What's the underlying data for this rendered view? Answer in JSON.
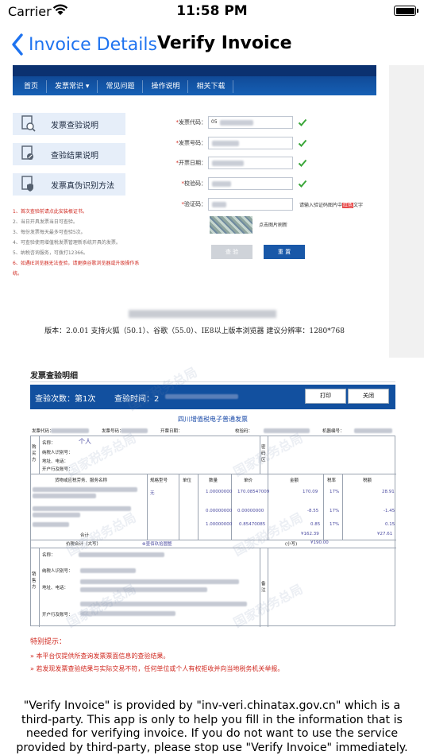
{
  "status_bar": {
    "carrier": "Carrier",
    "time": "11:58 PM"
  },
  "nav": {
    "back_label": "Invoice Details",
    "title": "Verify Invoice"
  },
  "query_page": {
    "menu": [
      "首页",
      "发票常识",
      "常见问题",
      "操作说明",
      "相关下载"
    ],
    "side_buttons": [
      "发票查验说明",
      "查验结果说明",
      "发票真伪识别方法"
    ],
    "tips": [
      "1、首次查验前请点此安装根证书。",
      "2、当日开具发票当日可查验。",
      "3、每份发票每天最多可查验5次。",
      "4、可查验使用增值税发票管理新系统开具的发票。",
      "5、纳税咨询服务，可拨打12366。",
      "6、如遇IE浏览器无法查验，请更换谷歌浏览器或升级操作系统。"
    ],
    "form": {
      "code_label": "发票代码：",
      "code_value": "05",
      "number_label": "发票号码：",
      "date_label": "开票日期：",
      "checkcode_label": "校验码：",
      "captcha_label": "验证码：",
      "captcha_hint_pre": "请输入验证码图片中",
      "captcha_hint_hl": "红色",
      "captcha_hint_post": "文字",
      "captcha_refresh": "点击图片刷新",
      "btn_check": "查 验",
      "btn_reset": "重 置"
    },
    "version_line": "版本：2.0.01  支持火狐（50.1）、谷歌（55.0）、IE8以上版本浏览器  建议分辨率：1280*768"
  },
  "detail_page": {
    "heading": "发票查验明细",
    "check_count": "查验次数：第1次",
    "check_time_label": "查验时间：2",
    "btn_print": "打印",
    "btn_close": "关闭",
    "invoice_title": "四川增值税电子普通发票",
    "meta": {
      "code": "发票代码：",
      "number": "发票号码：",
      "date": "开票日期：",
      "checkcode": "校验码：",
      "machine": "机器编号："
    },
    "buyer": {
      "side": "购买方",
      "name_label": "名称：",
      "name_value": "个人",
      "taxid_label": "纳税人识别号：",
      "addr_label": "地址、电话：",
      "bank_label": "开户行及账号：",
      "cipher_label": "密码区"
    },
    "columns": [
      "货物或应税劳务、服务名称",
      "规格型号",
      "单位",
      "数量",
      "单价",
      "金额",
      "税率",
      "税额"
    ],
    "rows": [
      {
        "spec": "无",
        "qty": "1.00000000",
        "price": "170.08547009",
        "amount": "170.09",
        "rate": "17%",
        "tax": "28.91"
      },
      {
        "spec": "",
        "qty": "0.00000000",
        "price": "0.00000000",
        "amount": "-8.55",
        "rate": "17%",
        "tax": "-1.45"
      },
      {
        "spec": "",
        "qty": "1.00000000",
        "price": "0.85470085",
        "amount": "0.85",
        "rate": "17%",
        "tax": "0.15"
      }
    ],
    "total_label": "合计",
    "total_amount": "¥162.39",
    "total_tax": "¥27.61",
    "grand_label": "价税合计（大写）",
    "grand_upper": "⊗壹佰玖拾圆整",
    "grand_small_label": "(小写)",
    "grand_small": "¥190.00",
    "seller": {
      "side": "销售方",
      "name_label": "名称：",
      "taxid_label": "纳税人识别号：",
      "addr_label": "地址、电话：",
      "bank_label": "开户行及账号：",
      "remark_label": "备注"
    },
    "watermark": "国家税务总局",
    "notice_title": "特别提示：",
    "notices": [
      "»  本平台仅提供所查询发票票面信息的查验结果。",
      "»  若发现发票查验结果与实际交易不符，任何单位或个人有权拒收并向当地税务机关举报。"
    ]
  },
  "disclaimer": "\"Verify Invoice\" is provided by \"inv-veri.chinatax.gov.cn\" which is a third-party. This app is only to help you fill in the information that is needed for verifying invoice. If you do not want to use the service provided by third-party, please stop use \"Verify Invoice\" immediately.",
  "colors": {
    "ios_blue": "#1e73f0",
    "site_blue": "#12509f",
    "alert_red": "#d0281f"
  }
}
